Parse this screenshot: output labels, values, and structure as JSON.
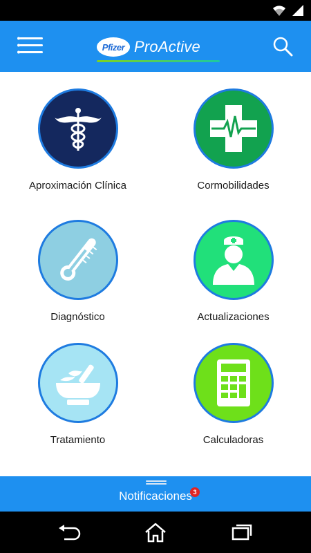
{
  "app": {
    "logo_mark": "Pfizer",
    "logo_text": "ProActive"
  },
  "status_bar": {
    "icons": [
      "wifi-icon",
      "signal-icon"
    ]
  },
  "menu": [
    {
      "label": "Aproximación Clínica",
      "icon": "caduceus-icon",
      "color": "#14285e"
    },
    {
      "label": "Cormobilidades",
      "icon": "medical-cross-icon",
      "color": "#12a24f"
    },
    {
      "label": "Diagnóstico",
      "icon": "thermometer-icon",
      "color": "#8ecfe2"
    },
    {
      "label": "Actualizaciones",
      "icon": "nurse-icon",
      "color": "#21e07a"
    },
    {
      "label": "Tratamiento",
      "icon": "mortar-pestle-icon",
      "color": "#a6e4f4"
    },
    {
      "label": "Calculadoras",
      "icon": "calculator-icon",
      "color": "#6ee01a"
    }
  ],
  "notifications": {
    "label": "Notificaciones",
    "count": "3"
  },
  "colors": {
    "primary": "#1e90f0",
    "circle_border": "#1e7be0"
  }
}
